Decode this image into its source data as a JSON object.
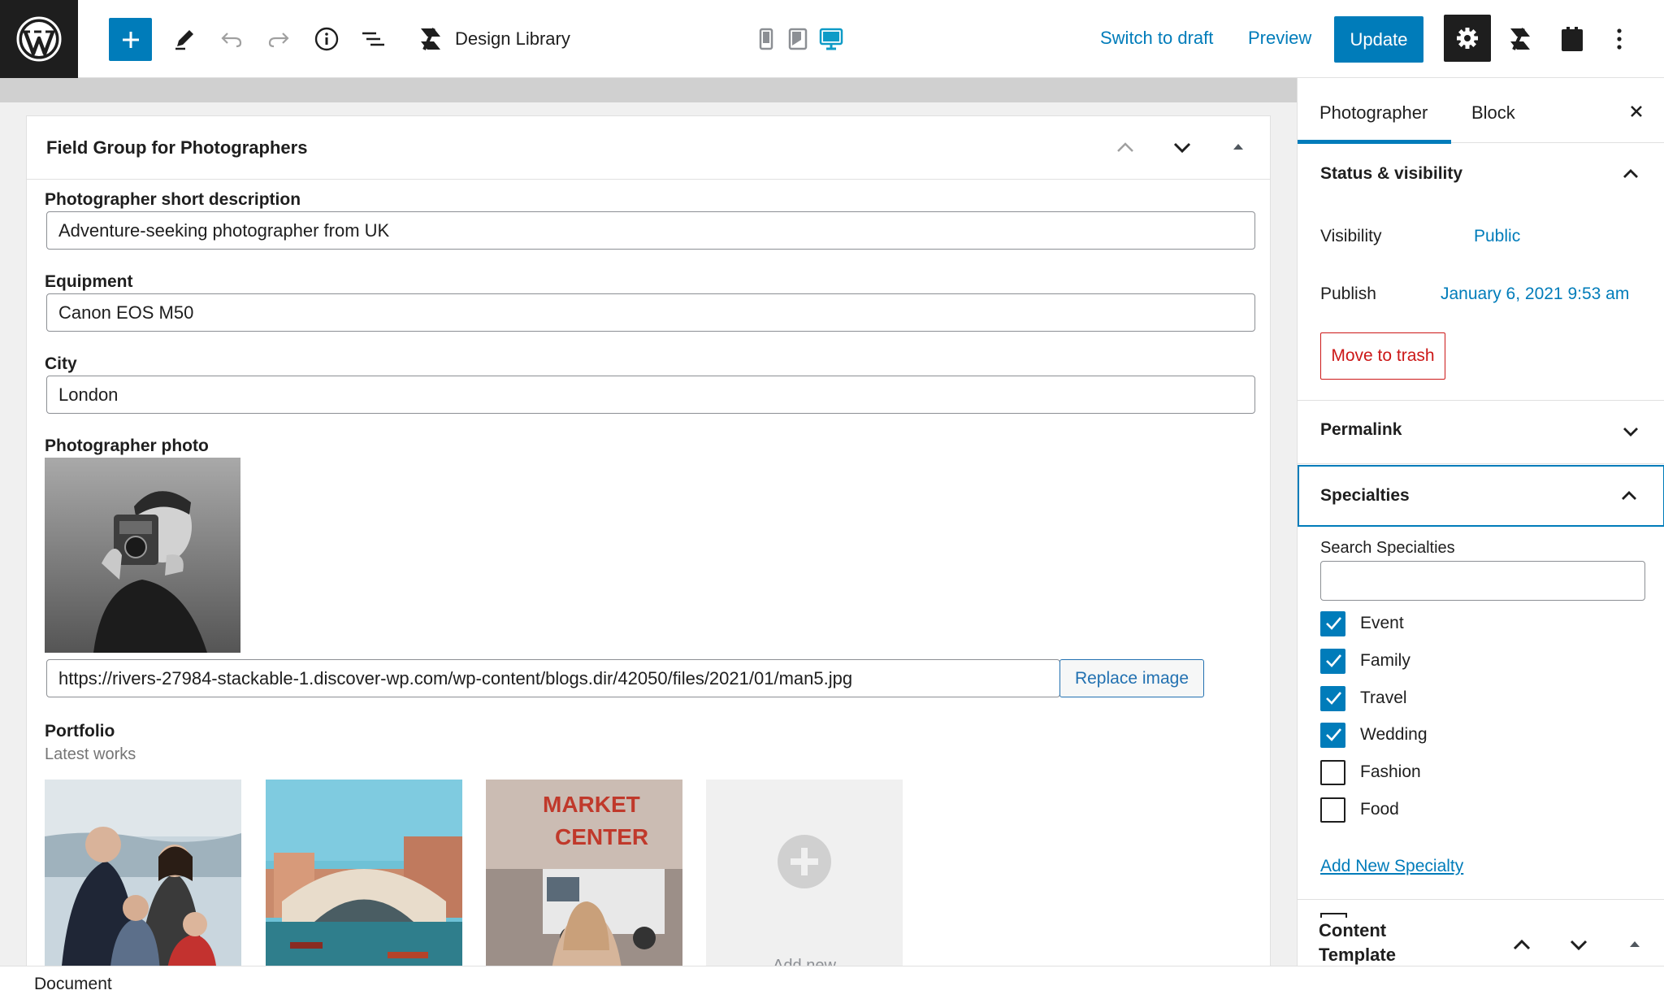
{
  "toolbar": {
    "design_library_label": "Design Library",
    "switch_to_draft": "Switch to draft",
    "preview": "Preview",
    "update": "Update"
  },
  "metabox": {
    "title": "Field Group for Photographers",
    "fields": {
      "short_description": {
        "label": "Photographer short description",
        "value": "Adventure-seeking photographer from UK"
      },
      "equipment": {
        "label": "Equipment",
        "value": "Canon EOS M50"
      },
      "city": {
        "label": "City",
        "value": "London"
      },
      "photo": {
        "label": "Photographer photo",
        "url": "https://rivers-27984-stackable-1.discover-wp.com/wp-content/blogs.dir/42050/files/2021/01/man5.jpg",
        "replace_label": "Replace image"
      },
      "portfolio": {
        "label": "Portfolio",
        "description": "Latest works",
        "add_new": "Add new"
      }
    }
  },
  "sidebar": {
    "tabs": [
      "Photographer",
      "Block"
    ],
    "status": {
      "title": "Status & visibility",
      "visibility_label": "Visibility",
      "visibility_value": "Public",
      "publish_label": "Publish",
      "publish_value": "January 6, 2021 9:53 am",
      "trash": "Move to trash"
    },
    "permalink": {
      "title": "Permalink"
    },
    "specialties": {
      "title": "Specialties",
      "search_label": "Search Specialties",
      "items": [
        {
          "label": "Event",
          "checked": true
        },
        {
          "label": "Family",
          "checked": true
        },
        {
          "label": "Travel",
          "checked": true
        },
        {
          "label": "Wedding",
          "checked": true
        },
        {
          "label": "Fashion",
          "checked": false
        },
        {
          "label": "Food",
          "checked": false
        }
      ],
      "add_new": "Add New Specialty"
    },
    "content_template": {
      "title": "Content Template"
    }
  },
  "bottombar": {
    "label": "Document"
  },
  "colors": {
    "accent": "#007cba",
    "danger": "#cc1818",
    "dark": "#1e1e1e"
  }
}
